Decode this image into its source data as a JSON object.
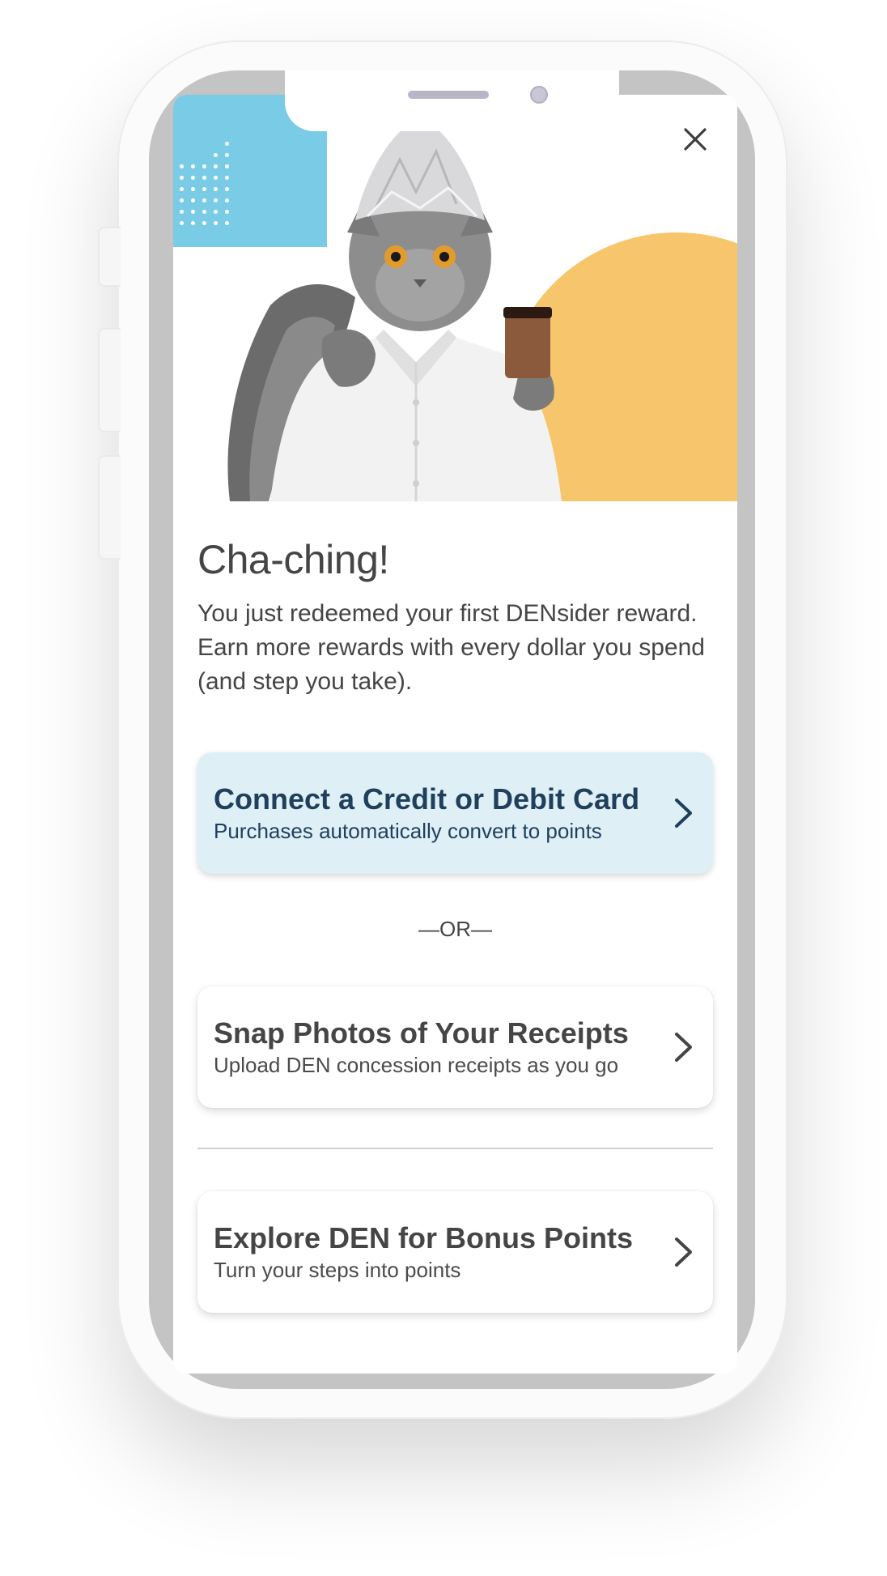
{
  "icons": {
    "close": "close-icon",
    "chevron": "chevron-right-icon"
  },
  "colors": {
    "accent_blue": "#7acce6",
    "accent_yellow": "#f7c56b",
    "primary_card_bg": "#dfeff6",
    "primary_text": "#1f3f5d",
    "body_text": "#454545"
  },
  "hero": {
    "image": "cat in tin foil hat holding coffee"
  },
  "reward": {
    "title": "Cha-ching!",
    "description": "You just redeemed your first DENsider reward. Earn more rewards with every dollar you spend (and step you take)."
  },
  "options": {
    "connect_card": {
      "title": "Connect a Credit or Debit Card",
      "subtitle": "Purchases automatically convert to points"
    },
    "separator": "—OR—",
    "receipts": {
      "title": "Snap Photos of Your Receipts",
      "subtitle": "Upload DEN concession receipts as you go"
    },
    "explore": {
      "title": "Explore DEN for Bonus Points",
      "subtitle": "Turn your steps into points"
    }
  }
}
